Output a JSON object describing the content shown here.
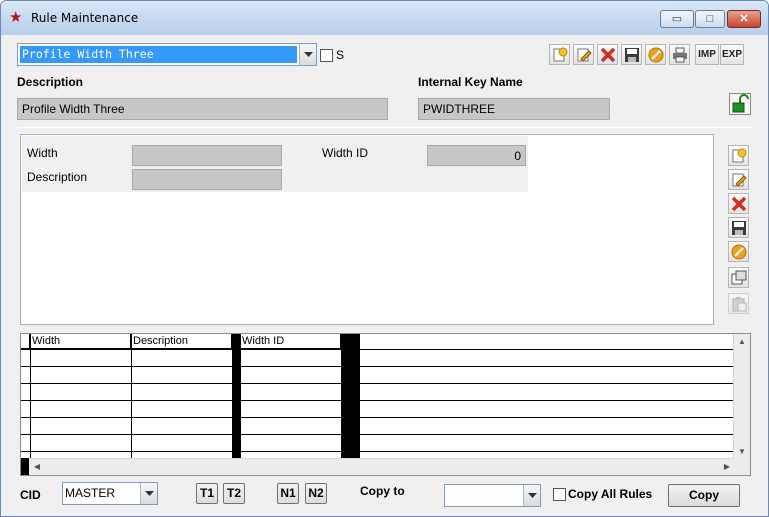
{
  "window": {
    "title": "Rule Maintenance",
    "min_glyph": "▭",
    "max_glyph": "□",
    "close_glyph": "✕",
    "app_icon": "star-icon"
  },
  "top": {
    "profile_value": "Profile Width Three",
    "s_label": "S",
    "description_label": "Description",
    "description_value": "Profile Width Three",
    "internal_key_label": "Internal Key Name",
    "internal_key_value": "PWIDTHREE",
    "imp_label": "IMP",
    "exp_label": "EXP"
  },
  "detail": {
    "width_label": "Width",
    "width_value": "",
    "description_label": "Description",
    "description_value": "",
    "width_id_label": "Width ID",
    "width_id_value": "0"
  },
  "grid": {
    "columns": [
      "Width",
      "Description",
      "Width ID"
    ]
  },
  "bottom": {
    "cid_label": "CID",
    "cid_value": "MASTER",
    "t1": "T1",
    "t2": "T2",
    "n1": "N1",
    "n2": "N2",
    "copy_to_label": "Copy to",
    "copy_to_value": "",
    "copy_all_rules_label": "Copy All Rules",
    "copy_button": "Copy"
  },
  "colors": {
    "title_gradient": "#c6d9f1",
    "selection": "#3399ff",
    "readonly_bg": "#c7c7c7",
    "close_button": "#c8442d"
  }
}
